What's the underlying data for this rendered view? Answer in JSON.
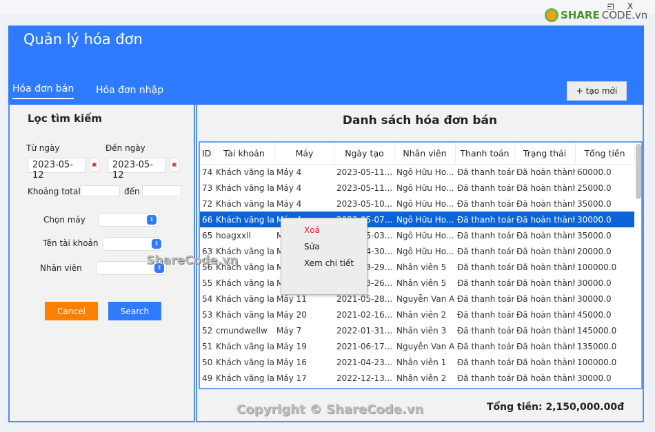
{
  "window": {
    "minimize": "–",
    "restore": "❐",
    "close": "X"
  },
  "watermark": {
    "logo": "SHARECODE.vn",
    "logo_a": "SHARE",
    "logo_b": "CODE.vn",
    "mid": "ShareCode.vn",
    "bottom": "Copyright © ShareCode.vn"
  },
  "header": {
    "title": "Quản lý hóa đơn",
    "tabs": [
      {
        "label": "Hóa đơn bán",
        "active": true
      },
      {
        "label": "Hóa đơn nhập",
        "active": false
      }
    ],
    "new_button": "+ tạo mới"
  },
  "colors": {
    "primary": "#2f7bff",
    "cancel": "#ff8000",
    "selected_row": "#0b63d8",
    "delete": "#e02020"
  },
  "filter": {
    "title": "Lọc tìm kiếm",
    "from_date_label": "Từ ngày",
    "from_date": "2023-05-12",
    "to_date_label": "Đến ngày",
    "to_date": "2023-05-12",
    "total_label": "Khoảng total",
    "total_to_label": "đến",
    "machine_label": "Chọn máy",
    "account_label": "Tên tài khoản",
    "staff_label": "Nhân viên",
    "cancel": "Cancel",
    "search": "Search"
  },
  "list": {
    "title": "Danh sách hóa đơn bán",
    "columns": [
      "ID",
      "Tài khoản",
      "Máy",
      "Ngày tạo",
      "Nhân viên",
      "Thanh toán",
      "Trạng thái",
      "Tổng tiền"
    ],
    "rows": [
      [
        "74",
        "Khách vãng lai",
        "Máy 4",
        "2023-05-11...",
        "Ngô Hữu Ho...",
        "Đã thanh toán",
        "Đã hoàn thành",
        "60000.0"
      ],
      [
        "73",
        "Khách vãng lai",
        "Máy 4",
        "2023-05-11...",
        "Ngô Hữu Ho...",
        "Đã thanh toán",
        "Đã hoàn thành",
        "25000.0"
      ],
      [
        "72",
        "Khách vãng lai",
        "Máy 4",
        "2023-05-10...",
        "Ngô Hữu Ho...",
        "Đã thanh toán",
        "Đã hoàn thành",
        "35000.0"
      ],
      [
        "66",
        "Khách vãng lai",
        "Máy 4",
        "2023-05-07...",
        "Ngô Hữu Ho...",
        "Đã thanh toán",
        "Đã hoàn thành",
        "30000.0"
      ],
      [
        "65",
        "hoagxxll",
        "Máy 4",
        "2023-05-03...",
        "Ngô Hữu Ho...",
        "Đã thanh toán",
        "Đã hoàn thành",
        "35000.0"
      ],
      [
        "63",
        "Khách vãng lai",
        "Máy 4",
        "2023-04-30...",
        "Ngô Hữu Ho...",
        "Đã thanh toán",
        "Đã hoàn thành",
        "20000.0"
      ],
      [
        "56",
        "Khách vãng lai",
        "Máy 4",
        "2022-03-29...",
        "Nhân viên 5",
        "Đã thanh toán",
        "Đã hoàn thành",
        "100000.0"
      ],
      [
        "55",
        "Khách vãng lai",
        "Máy 20",
        "2022-03-26...",
        "Nhân viên 5",
        "Đã thanh toán",
        "Đã hoàn thành",
        "30000.0"
      ],
      [
        "54",
        "Khách vãng lai",
        "Máy 11",
        "2021-05-28...",
        "Nguyễn Van A",
        "Đã thanh toán",
        "Đã hoàn thành",
        "30000.0"
      ],
      [
        "53",
        "Khách vãng lai",
        "Máy 20",
        "2021-02-16...",
        "Nhân viên 2",
        "Đã thanh toán",
        "Đã hoàn thành",
        "45000.0"
      ],
      [
        "52",
        "cmundwellw",
        "Máy 7",
        "2022-01-31...",
        "Nhân viên 3",
        "Đã thanh toán",
        "Đã hoàn thành",
        "145000.0"
      ],
      [
        "51",
        "Khách vãng lai",
        "Máy 19",
        "2021-06-17...",
        "Nguyễn Van A",
        "Đã thanh toán",
        "Đã hoàn thành",
        "135000.0"
      ],
      [
        "50",
        "Khách vãng lai",
        "Máy 16",
        "2021-04-23...",
        "Nhân viên 1",
        "Đã thanh toán",
        "Đã hoàn thành",
        "100000.0"
      ],
      [
        "49",
        "Khách vãng lai",
        "Máy 17",
        "2022-12-13...",
        "Nhân viên 2",
        "Đã thanh toán",
        "Đã hoàn thành",
        "30000.0"
      ]
    ],
    "selected_index": 3,
    "total": "Tổng tiền: 2,150,000.00đ"
  },
  "context_menu": {
    "items": [
      "Xoá",
      "Sửa",
      "Xem chi tiết"
    ]
  }
}
